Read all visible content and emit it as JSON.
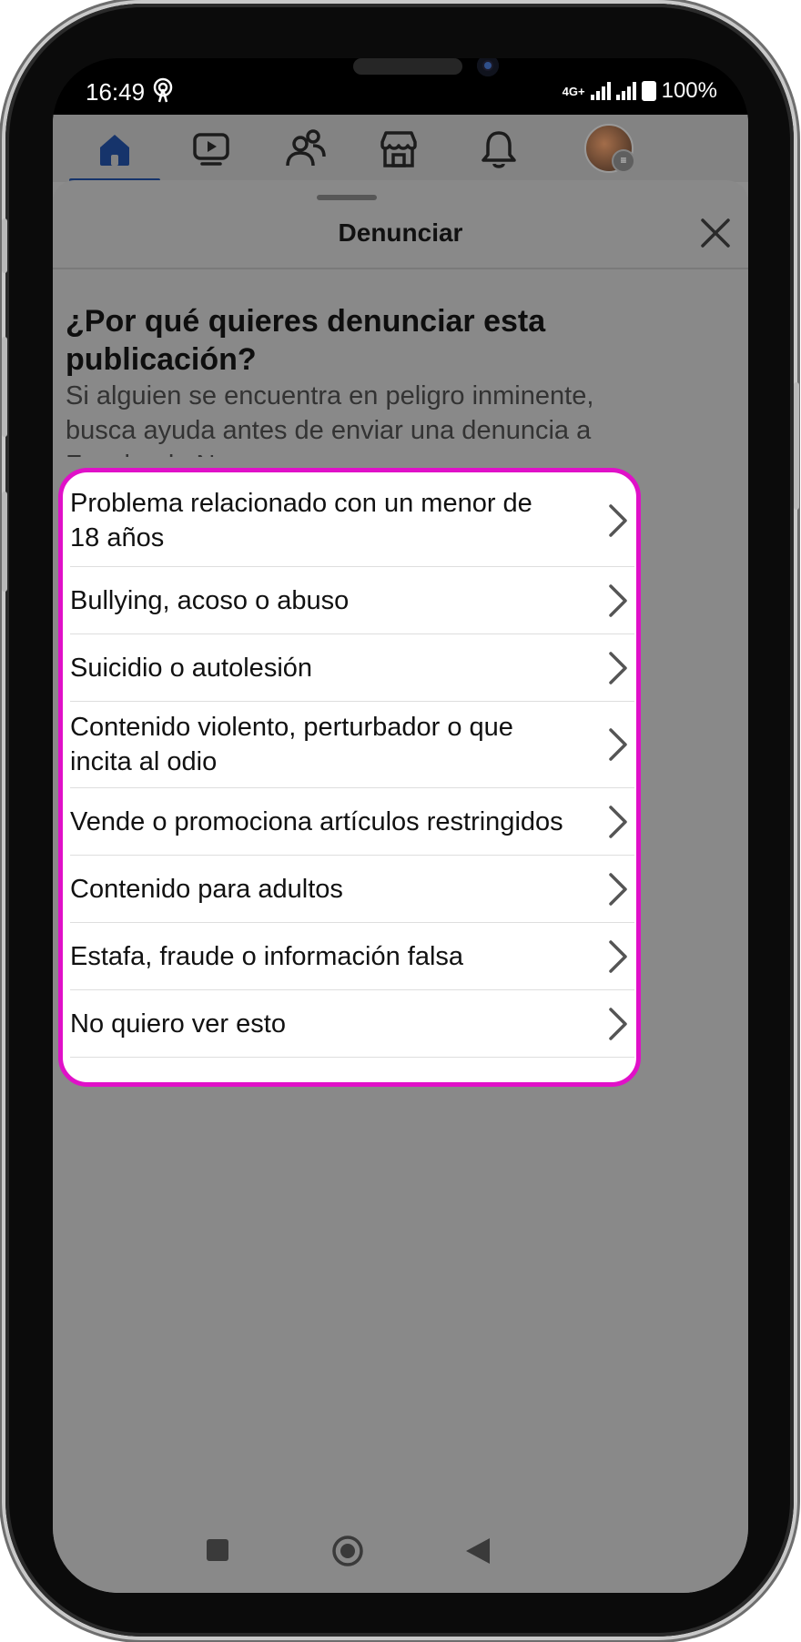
{
  "status_bar": {
    "time": "16:49",
    "network": "4G+",
    "battery": "100%"
  },
  "top_nav": {
    "items": [
      {
        "icon": "home-icon",
        "active": true
      },
      {
        "icon": "video-icon",
        "active": false
      },
      {
        "icon": "friends-icon",
        "active": false
      },
      {
        "icon": "marketplace-icon",
        "active": false
      },
      {
        "icon": "bell-icon",
        "active": false
      },
      {
        "icon": "avatar",
        "active": false
      }
    ]
  },
  "sheet": {
    "title": "Denunciar",
    "question": "¿Por qué quieres denunciar esta publicación?",
    "subtext": "Si alguien se encuentra en peligro inminente, busca ayuda antes de enviar una denuncia a Facebook. No esperes.",
    "options": [
      "Problema relacionado con un menor de 18 años",
      "Bullying, acoso o abuso",
      "Suicidio o autolesión",
      "Contenido violento, perturbador o que incita al odio",
      "Vende o promociona artículos restringidos",
      "Contenido para adultos",
      "Estafa, fraude o información falsa",
      "No quiero ver esto"
    ]
  },
  "colors": {
    "accent": "#16346b",
    "highlight_border": "#e010c8",
    "overlay": "#898989"
  }
}
